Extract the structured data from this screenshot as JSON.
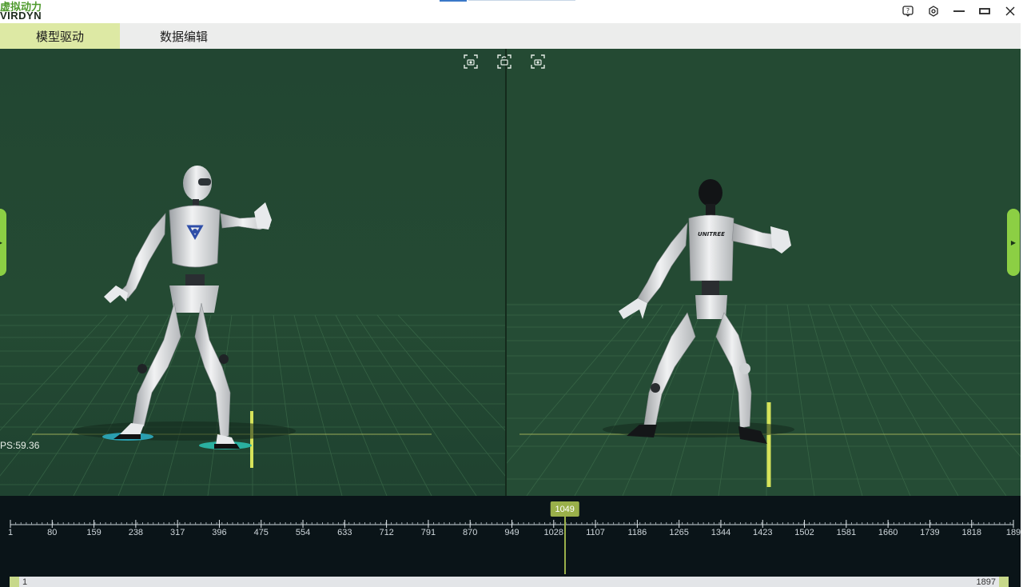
{
  "app": {
    "logo_cn": "虚拟动力",
    "logo_en": "VIRDYN"
  },
  "window": {
    "help_icon": "help-icon",
    "settings_icon": "gear-icon",
    "minimize_icon": "minimize-icon",
    "maximize_icon": "maximize-icon",
    "close_icon": "close-icon"
  },
  "tabs": [
    {
      "label": "模型驱动",
      "active": true
    },
    {
      "label": "数据编辑",
      "active": false
    }
  ],
  "viewport": {
    "fps_label": "PS:59.36",
    "left_robot_logo": "virdyn-v-logo",
    "right_robot_brand": "UNITREE",
    "tool_icons": [
      "camera-snapshot-icon",
      "camera-sync-icon",
      "camera-snapshot-icon"
    ]
  },
  "timeline": {
    "ticks": [
      "1",
      "80",
      "159",
      "238",
      "317",
      "396",
      "475",
      "554",
      "633",
      "712",
      "791",
      "870",
      "949",
      "1028",
      "1107",
      "1186",
      "1265",
      "1344",
      "1423",
      "1502",
      "1581",
      "1660",
      "1739",
      "1818",
      "189"
    ],
    "total_frames": 1897,
    "current_frame": "1049",
    "range_start": "1",
    "range_end": "1897"
  },
  "colors": {
    "accent": "#8ccf44",
    "cursor": "#9ab04a",
    "viewport_bg": "#244a33",
    "timeline_bg": "#0a1418",
    "active_tab": "#dde9a4"
  }
}
